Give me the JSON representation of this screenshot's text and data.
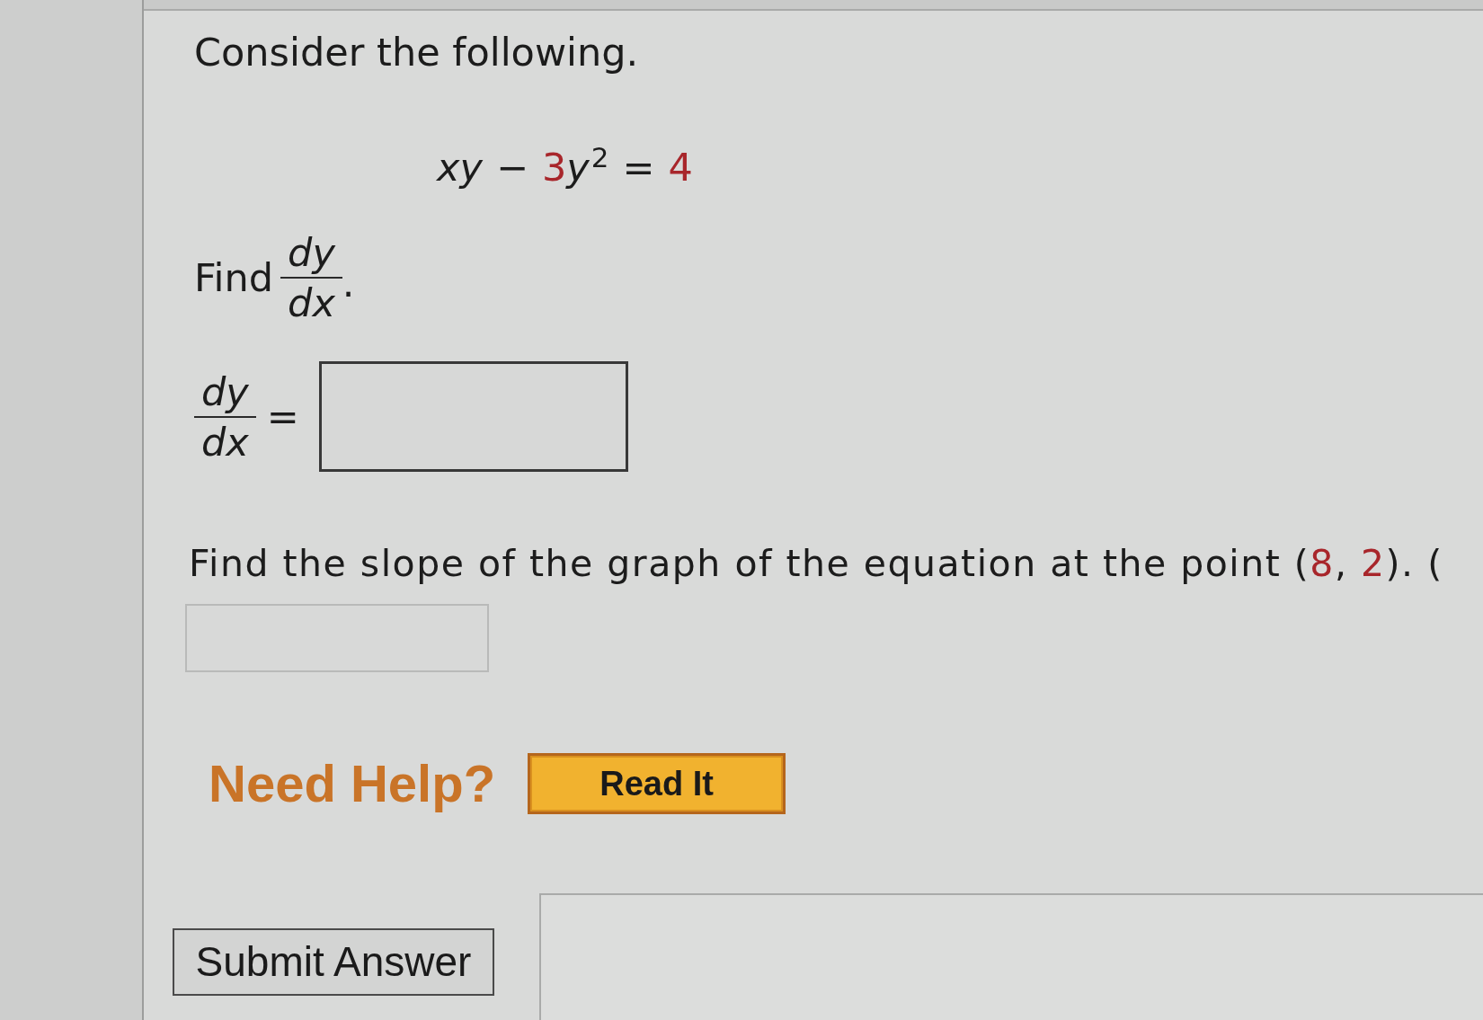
{
  "intro": "Consider the following.",
  "equation": [
    {
      "kind": "variable",
      "text": "xy"
    },
    {
      "kind": "operator",
      "text": "−"
    },
    {
      "kind": "number",
      "text": "3"
    },
    {
      "kind": "variable",
      "text": "y"
    },
    {
      "kind": "exponent",
      "text": "2"
    },
    {
      "kind": "operator",
      "text": "="
    },
    {
      "kind": "number",
      "text": "4"
    }
  ],
  "derivative_prompt": {
    "text": "Find",
    "numerator": "dy",
    "denominator": "dx",
    "end": "."
  },
  "derivative_answer": {
    "numerator": "dy",
    "denominator": "dx",
    "relation": "=",
    "disabled": false
  },
  "slope_prompt": [
    {
      "kind": "text",
      "text": "Find the slope of the graph of the equation at the point ("
    },
    {
      "kind": "number",
      "text": "8"
    },
    {
      "kind": "text",
      "text": ", "
    },
    {
      "kind": "number",
      "text": "2"
    },
    {
      "kind": "text",
      "text": "). ("
    }
  ],
  "slope_answer": {
    "disabled": true
  },
  "help": {
    "label": "Need Help?",
    "buttons": [
      "Read It"
    ]
  },
  "submit_button": "Submit Answer"
}
